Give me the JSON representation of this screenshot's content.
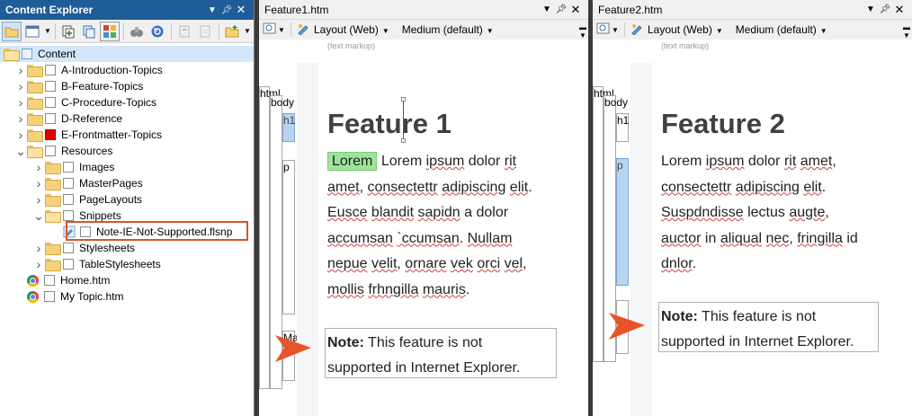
{
  "explorer": {
    "title": "Content Explorer",
    "tree": [
      {
        "label": "Content",
        "level": 0,
        "type": "root",
        "expanded": "none",
        "selected": true
      },
      {
        "label": "A-Introduction-Topics",
        "level": 1,
        "type": "folder",
        "expanded": "collapsed"
      },
      {
        "label": "B-Feature-Topics",
        "level": 1,
        "type": "folder",
        "expanded": "collapsed"
      },
      {
        "label": "C-Procedure-Topics",
        "level": 1,
        "type": "folder",
        "expanded": "collapsed"
      },
      {
        "label": "D-Reference",
        "level": 1,
        "type": "folder",
        "expanded": "collapsed"
      },
      {
        "label": "E-Frontmatter-Topics",
        "level": 1,
        "type": "folder",
        "expanded": "collapsed",
        "checkbox": "red"
      },
      {
        "label": "Resources",
        "level": 1,
        "type": "folder-open",
        "expanded": "expanded"
      },
      {
        "label": "Images",
        "level": 2,
        "type": "folder",
        "expanded": "collapsed"
      },
      {
        "label": "MasterPages",
        "level": 2,
        "type": "folder",
        "expanded": "collapsed"
      },
      {
        "label": "PageLayouts",
        "level": 2,
        "type": "folder",
        "expanded": "collapsed"
      },
      {
        "label": "Snippets",
        "level": 2,
        "type": "folder-open",
        "expanded": "expanded"
      },
      {
        "label": "Note-IE-Not-Supported.flsnp",
        "level": 3,
        "type": "snippet",
        "expanded": "none"
      },
      {
        "label": "Stylesheets",
        "level": 2,
        "type": "folder",
        "expanded": "collapsed"
      },
      {
        "label": "TableStylesheets",
        "level": 2,
        "type": "folder",
        "expanded": "collapsed"
      },
      {
        "label": "Home.htm",
        "level": 1,
        "type": "chrome",
        "expanded": "none"
      },
      {
        "label": "My Topic.htm",
        "level": 1,
        "type": "chrome",
        "expanded": "none"
      }
    ]
  },
  "editor1": {
    "title": "Feature1.htm",
    "layout": "Layout (Web)",
    "medium": "Medium (default)",
    "markup_note": "(text markup)",
    "gutter": {
      "html": "html",
      "body": "body",
      "h1": "h1",
      "p": "p",
      "div": "Ma"
    },
    "heading": "Feature 1",
    "lorem_highlight": "Lorem",
    "lines": [
      [
        {
          "t": "Lorem ",
          "sq": false
        },
        {
          "t": "ipsum",
          "sq": true
        },
        {
          "t": " dolor ",
          "sq": false
        },
        {
          "t": "rit",
          "sq": true
        }
      ],
      [
        {
          "t": "amet",
          "sq": true
        },
        {
          "t": ", ",
          "sq": false
        },
        {
          "t": "consectettr",
          "sq": true
        },
        {
          "t": " ",
          "sq": false
        },
        {
          "t": "adipiscing",
          "sq": true
        },
        {
          "t": " ",
          "sq": false
        },
        {
          "t": "elit",
          "sq": true
        },
        {
          "t": ".",
          "sq": false
        }
      ],
      [
        {
          "t": "Eusce",
          "sq": true
        },
        {
          "t": " ",
          "sq": false
        },
        {
          "t": "blandit",
          "sq": true
        },
        {
          "t": " ",
          "sq": false
        },
        {
          "t": "sapidn",
          "sq": true
        },
        {
          "t": " a dolor",
          "sq": false
        }
      ],
      [
        {
          "t": "accumsan",
          "sq": true
        },
        {
          "t": " ",
          "sq": false
        },
        {
          "t": "`ccumsan",
          "sq": true
        },
        {
          "t": ". ",
          "sq": false
        },
        {
          "t": "Nullam",
          "sq": true
        }
      ],
      [
        {
          "t": "nepue",
          "sq": true
        },
        {
          "t": " ",
          "sq": false
        },
        {
          "t": "velit",
          "sq": true
        },
        {
          "t": ", ",
          "sq": false
        },
        {
          "t": "ornare",
          "sq": true
        },
        {
          "t": " ",
          "sq": false
        },
        {
          "t": "vek",
          "sq": true
        },
        {
          "t": " ",
          "sq": false
        },
        {
          "t": "orci",
          "sq": true
        },
        {
          "t": " ",
          "sq": false
        },
        {
          "t": "vel",
          "sq": true
        },
        {
          "t": ",",
          "sq": false
        }
      ],
      [
        {
          "t": "mollis",
          "sq": true
        },
        {
          "t": " ",
          "sq": false
        },
        {
          "t": "frhngilla",
          "sq": true
        },
        {
          "t": " ",
          "sq": false
        },
        {
          "t": "mauris",
          "sq": true
        },
        {
          "t": ".",
          "sq": false
        }
      ]
    ],
    "note_label": "Note:",
    "note_line1": " This feature is not",
    "note_line2": "supported in Internet Explorer."
  },
  "editor2": {
    "title": "Feature2.htm",
    "layout": "Layout (Web)",
    "medium": "Medium (default)",
    "markup_note": "(text markup)",
    "gutter": {
      "html": "html",
      "body": "body",
      "h1": "h1",
      "p": "p"
    },
    "heading": "Feature 2",
    "lines": [
      [
        {
          "t": "Lorem ",
          "sq": false
        },
        {
          "t": "ipsum",
          "sq": true
        },
        {
          "t": " dolor ",
          "sq": false
        },
        {
          "t": "rit",
          "sq": true
        },
        {
          "t": " ",
          "sq": false
        },
        {
          "t": "amet",
          "sq": true
        },
        {
          "t": ",",
          "sq": false
        }
      ],
      [
        {
          "t": "consectettr",
          "sq": true
        },
        {
          "t": " ",
          "sq": false
        },
        {
          "t": "adipiscing",
          "sq": true
        },
        {
          "t": " ",
          "sq": false
        },
        {
          "t": "elit",
          "sq": true
        },
        {
          "t": ".",
          "sq": false
        }
      ],
      [
        {
          "t": "Suspdndisse",
          "sq": true
        },
        {
          "t": " lectus ",
          "sq": false
        },
        {
          "t": "augte",
          "sq": true
        },
        {
          "t": ",",
          "sq": false
        }
      ],
      [
        {
          "t": "auctor",
          "sq": true
        },
        {
          "t": " in ",
          "sq": false
        },
        {
          "t": "aliqual",
          "sq": true
        },
        {
          "t": " ",
          "sq": false
        },
        {
          "t": "nec",
          "sq": true
        },
        {
          "t": ", ",
          "sq": false
        },
        {
          "t": "fringilla",
          "sq": true
        },
        {
          "t": " id",
          "sq": false
        }
      ],
      [
        {
          "t": "dnlor",
          "sq": true
        },
        {
          "t": ".",
          "sq": false
        }
      ]
    ],
    "note_label": "Note:",
    "note_line1": " This feature is not",
    "note_line2": "supported in Internet Explorer."
  },
  "colors": {
    "accent_title": "#1f5d99",
    "highlight_box": "#d9532c",
    "arrow": "#e8542a",
    "lorem_highlight": "#9ee49a"
  },
  "icons": [
    "open-folder-icon",
    "window-icon",
    "add-files-icon",
    "copy-icon",
    "grid-icon",
    "binoculars-icon",
    "refresh-icon",
    "chevron-down-icon",
    "pin-icon",
    "close-icon",
    "zoom-icon",
    "layout-icon",
    "snippet-icon",
    "chrome-icon",
    "arrow-pointer-icon"
  ]
}
